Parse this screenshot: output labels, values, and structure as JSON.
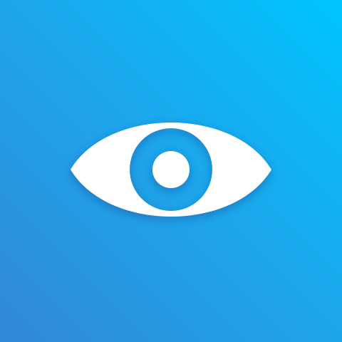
{
  "app_icon": {
    "icon": "eye-icon",
    "colors": {
      "gradient_top_right": "#00c4fd",
      "gradient_mid": "#1ba8ed",
      "gradient_bottom_left": "#3288d8",
      "glyph": "#ffffff",
      "shadow": "#1b3f8a"
    }
  }
}
